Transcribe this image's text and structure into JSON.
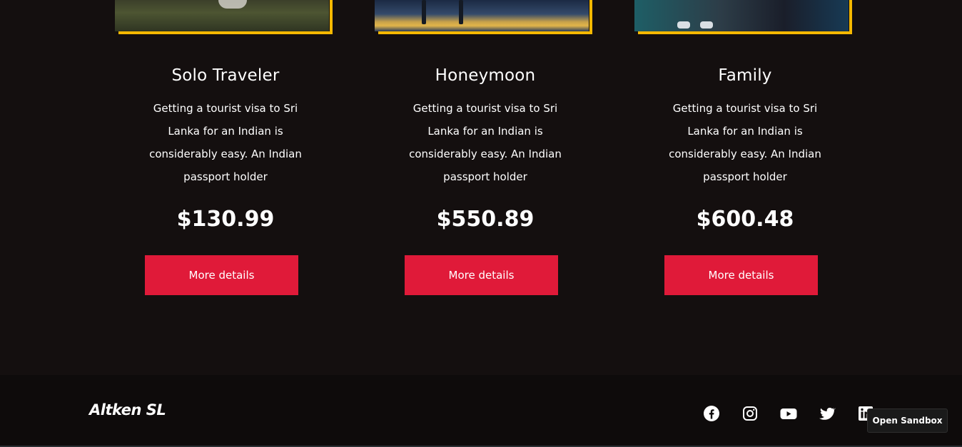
{
  "cards": [
    {
      "title": "Solo Traveler",
      "description": "Getting a tourist visa to Sri Lanka for an Indian is considerably easy. An Indian passport holder",
      "price": "$130.99",
      "button_label": "More details"
    },
    {
      "title": "Honeymoon",
      "description": "Getting a tourist visa to Sri Lanka for an Indian is considerably easy. An Indian passport holder",
      "price": "$550.89",
      "button_label": "More details"
    },
    {
      "title": "Family",
      "description": "Getting a tourist visa to Sri Lanka for an Indian is considerably easy. An Indian passport holder",
      "price": "$600.48",
      "button_label": "More details"
    }
  ],
  "footer": {
    "brand": "Altken SL",
    "social_icons": [
      "facebook-icon",
      "instagram-icon",
      "youtube-icon",
      "twitter-icon",
      "linkedin-icon"
    ]
  },
  "sandbox_button": "Open Sandbox",
  "colors": {
    "background": "#140f0f",
    "footer_background": "#0e0b0b",
    "accent_button": "#e01a39",
    "image_frame": "#f5b800",
    "text": "#ffffff"
  }
}
